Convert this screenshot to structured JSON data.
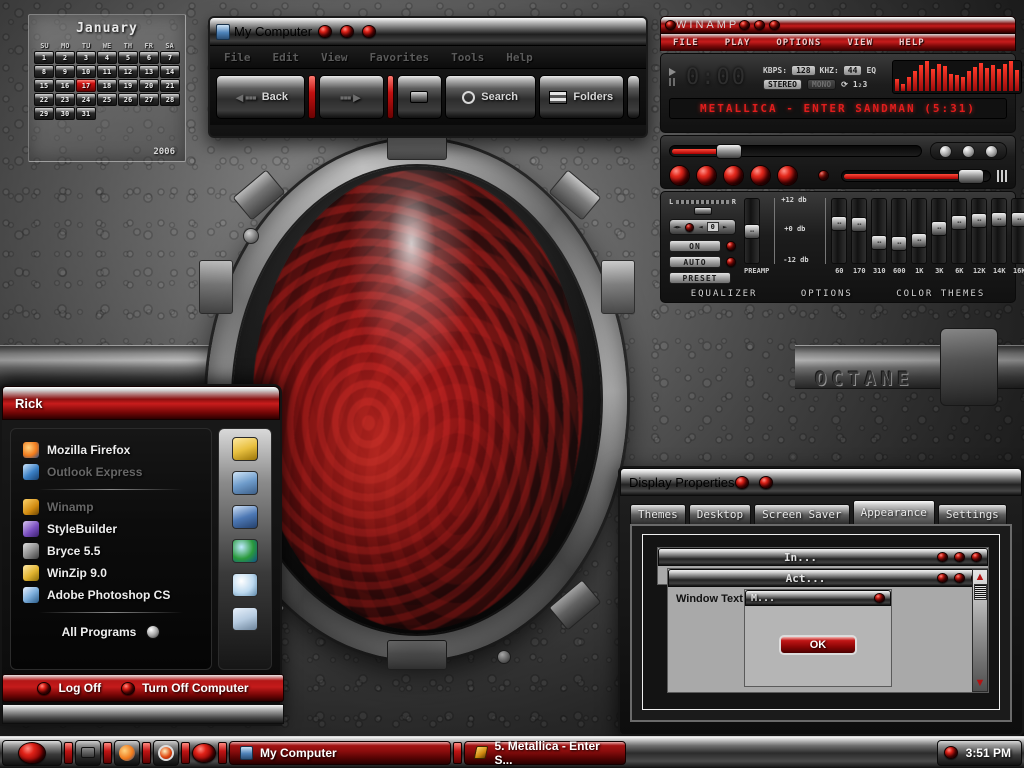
{
  "desktop": {
    "wallpaper_text": "OCTANE",
    "accent_red": "#c21616",
    "metal_light": "#f2f2f2",
    "metal_dark": "#1a1a1a"
  },
  "calendar": {
    "month": "January",
    "year": "2006",
    "weekdays": [
      "SU",
      "MO",
      "TU",
      "WE",
      "TH",
      "FR",
      "SA"
    ],
    "days": [
      1,
      2,
      3,
      4,
      5,
      6,
      7,
      8,
      9,
      10,
      11,
      12,
      13,
      14,
      15,
      16,
      17,
      18,
      19,
      20,
      21,
      22,
      23,
      24,
      25,
      26,
      27,
      28,
      29,
      30,
      31
    ],
    "today": 17
  },
  "mycomputer": {
    "title": "My Computer",
    "icon": "my-computer-icon",
    "menu": [
      "File",
      "Edit",
      "View",
      "Favorites",
      "Tools",
      "Help"
    ],
    "toolbar": [
      {
        "label": "Back",
        "icon": "back-arrow-icon"
      },
      {
        "label": "",
        "icon": "forward-arrow-icon"
      },
      {
        "label": "",
        "icon": "up-folder-icon"
      },
      {
        "label": "Search",
        "icon": "search-icon"
      },
      {
        "label": "Folders",
        "icon": "folders-icon"
      }
    ],
    "window_buttons": [
      "minimize",
      "maximize",
      "close"
    ]
  },
  "winamp": {
    "title": "WINAMP",
    "menu": [
      "FILE",
      "PLAY",
      "OPTIONS",
      "VIEW",
      "HELP"
    ],
    "time": "0:00",
    "kbps_label": "KBPS:",
    "kbps": "128",
    "khz_label": "KHZ:",
    "khz": "44",
    "eq_label": "EQ",
    "stereo": "STEREO",
    "mono": "MONO",
    "track": "METALLICA - ENTER SANDMAN (5:31)",
    "seek_percent": 21,
    "volume_percent": 80,
    "transport": [
      "previous",
      "play",
      "pause",
      "stop",
      "next"
    ],
    "equalizer": {
      "on_label": "ON",
      "auto_label": "AUTO",
      "preset_label": "PRESET",
      "balance_value": "0",
      "db_top": "+12 db",
      "db_mid": "+0 db",
      "db_bottom": "-12 db",
      "preamp_label": "PREAMP",
      "bands": [
        "60",
        "170",
        "310",
        "600",
        "1K",
        "3K",
        "6K",
        "12K",
        "14K",
        "16K"
      ],
      "band_values": [
        62,
        60,
        34,
        32,
        36,
        54,
        64,
        66,
        68,
        68
      ],
      "preamp_value": 50
    },
    "footer": [
      "EQUALIZER",
      "OPTIONS",
      "COLOR THEMES"
    ],
    "vis_bars": [
      12,
      7,
      14,
      20,
      26,
      30,
      22,
      27,
      25,
      17,
      16,
      14,
      20,
      24,
      28,
      23,
      26,
      22,
      27,
      30,
      21
    ]
  },
  "startmenu": {
    "user": "Rick",
    "programs": [
      {
        "label": "Mozilla Firefox",
        "icon": "firefox-icon",
        "dim": false
      },
      {
        "label": "Outlook Express",
        "icon": "outlook-express-icon",
        "dim": true
      },
      {
        "label": "Winamp",
        "icon": "winamp-icon",
        "dim": true
      },
      {
        "label": "StyleBuilder",
        "icon": "stylebuilder-icon",
        "dim": false
      },
      {
        "label": "Bryce 5.5",
        "icon": "bryce-icon",
        "dim": false
      },
      {
        "label": "WinZip 9.0",
        "icon": "winzip-icon",
        "dim": false
      },
      {
        "label": "Adobe Photoshop CS",
        "icon": "photoshop-icon",
        "dim": false
      }
    ],
    "all_programs": "All Programs",
    "right_icons": [
      "email-icon",
      "my-computer-icon",
      "control-panel-icon",
      "network-globe-icon",
      "search-icon",
      "documents-folder-icon"
    ],
    "log_off": "Log Off",
    "turn_off": "Turn Off Computer"
  },
  "display_properties": {
    "title": "Display Properties",
    "tabs": [
      "Themes",
      "Desktop",
      "Screen Saver",
      "Appearance",
      "Settings"
    ],
    "active_tab": "Appearance",
    "preview": {
      "inactive_window": "In...",
      "active_window": "Act...",
      "window_text": "Window Text",
      "message_box": "M...",
      "ok_button": "OK"
    },
    "window_buttons": [
      "help",
      "close"
    ]
  },
  "taskbar": {
    "start_icon": "start-orb-icon",
    "quicklaunch": [
      "show-desktop-icon",
      "firefox-icon",
      "media-player-icon"
    ],
    "tasks": [
      {
        "label": "My Computer",
        "icon": "my-computer-icon"
      },
      {
        "label": "5. Metallica - Enter S...",
        "icon": "winamp-icon"
      }
    ],
    "tray_icons": [
      "volume-icon"
    ],
    "clock": "3:51 PM"
  }
}
